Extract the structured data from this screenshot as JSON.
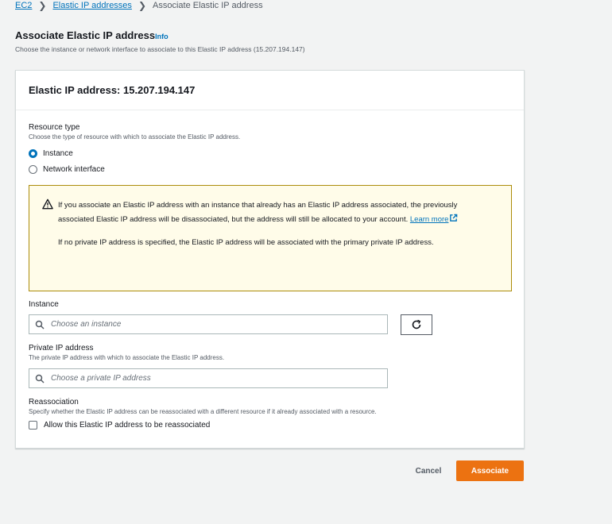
{
  "breadcrumb": {
    "root": "EC2",
    "parent": "Elastic IP addresses",
    "current": "Associate Elastic IP address"
  },
  "page": {
    "title": "Associate Elastic IP address",
    "info": "Info",
    "description": "Choose the instance or network interface to associate to this Elastic IP address (15.207.194.147)"
  },
  "card": {
    "header": "Elastic IP address: 15.207.194.147"
  },
  "resource_type": {
    "label": "Resource type",
    "hint": "Choose the type of resource with which to associate the Elastic IP address.",
    "options": [
      {
        "label": "Instance",
        "selected": true
      },
      {
        "label": "Network interface",
        "selected": false
      }
    ]
  },
  "alert": {
    "text1": "If you associate an Elastic IP address with an instance that already has an Elastic IP address associated, the previously associated Elastic IP address will be disassociated, but the address will still be allocated to your account. ",
    "link": "Learn more",
    "text2": "If no private IP address is specified, the Elastic IP address will be associated with the primary private IP address.",
    "color": "#fffce9"
  },
  "instance": {
    "label": "Instance",
    "placeholder": "Choose an instance"
  },
  "private_ip": {
    "label": "Private IP address",
    "hint": "The private IP address with which to associate the Elastic IP address.",
    "placeholder": "Choose a private IP address"
  },
  "reassociation": {
    "label": "Reassociation",
    "hint": "Specify whether the Elastic IP address can be reassociated with a different resource if it already associated with a resource.",
    "checkbox_label": "Allow this Elastic IP address to be reassociated",
    "checked": false
  },
  "actions": {
    "cancel": "Cancel",
    "associate": "Associate",
    "primary_color": "#ec7211"
  }
}
